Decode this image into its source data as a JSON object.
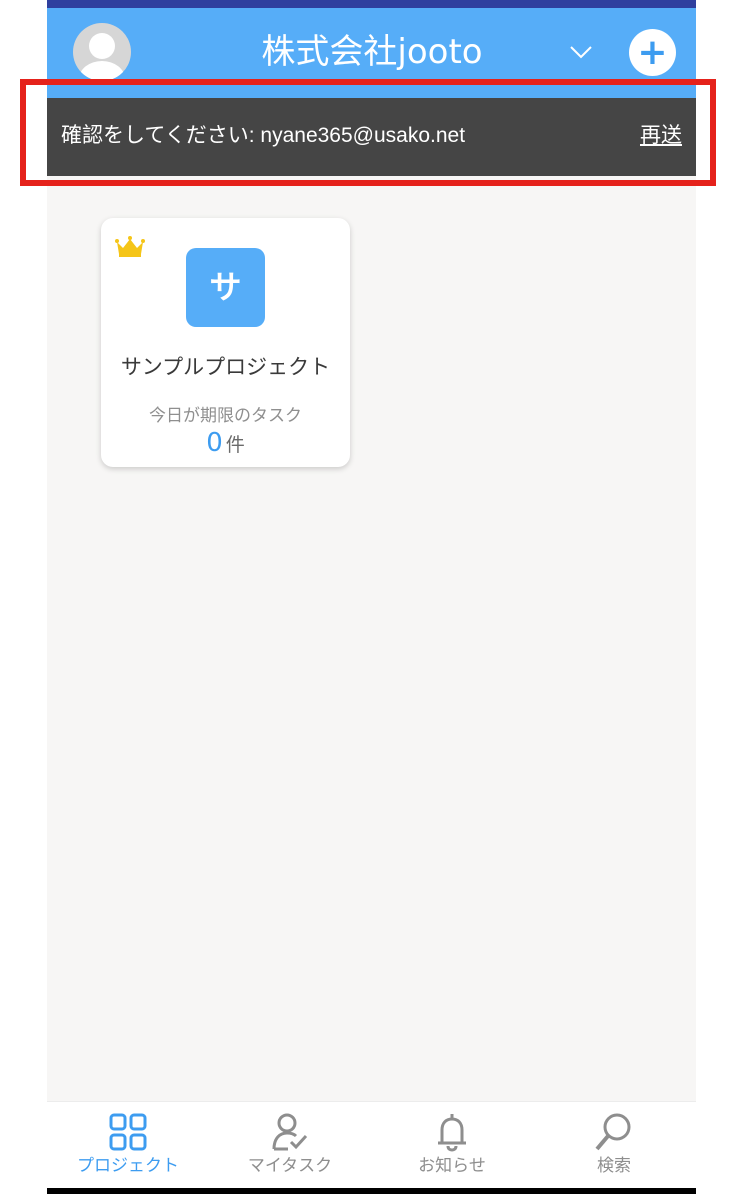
{
  "header": {
    "org_name": "株式会社jooto",
    "add_icon": "plus-icon"
  },
  "banner": {
    "message": "確認をしてください: nyane365@usako.net",
    "resend_label": "再送"
  },
  "projects": [
    {
      "name": "サンプルプロジェクト",
      "icon_letter": "サ",
      "due_today_label": "今日が期限のタスク",
      "due_today_count": "0",
      "due_today_unit": "件",
      "badge_icon": "crown-icon"
    }
  ],
  "tabs": [
    {
      "label": "プロジェクト",
      "icon": "grid-icon",
      "active": true
    },
    {
      "label": "マイタスク",
      "icon": "person-check-icon",
      "active": false
    },
    {
      "label": "お知らせ",
      "icon": "bell-icon",
      "active": false
    },
    {
      "label": "検索",
      "icon": "search-icon",
      "active": false
    }
  ],
  "colors": {
    "header_bg": "#56adf8",
    "top_strip": "#2f3f9e",
    "banner_bg": "#454545",
    "highlight": "#e5221b",
    "accent": "#3d9cf0",
    "crown": "#f5c518",
    "inactive_tab": "#8e8e8e"
  }
}
